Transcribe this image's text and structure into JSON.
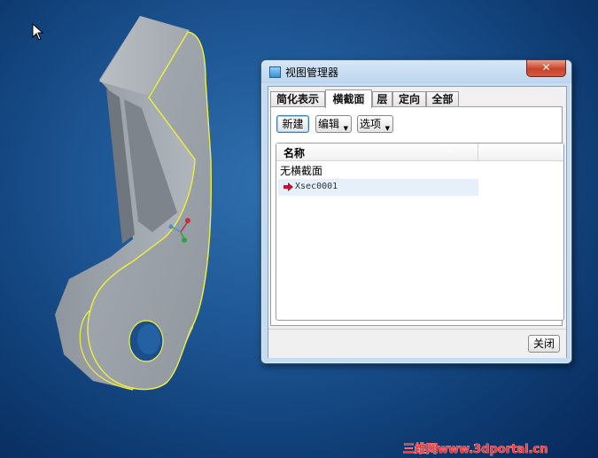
{
  "window": {
    "title": "视图管理器",
    "close_glyph": "✕"
  },
  "tabs": [
    {
      "label": "简化表示",
      "active": false
    },
    {
      "label": "横截面",
      "active": true
    },
    {
      "label": "层",
      "active": false
    },
    {
      "label": "定向",
      "active": false
    },
    {
      "label": "全部",
      "active": false
    }
  ],
  "toolbar": {
    "new_label": "新建",
    "edit_label": "编辑",
    "options_label": "选项"
  },
  "list": {
    "column_name": "名称",
    "rows": [
      {
        "label": "无横截面",
        "selected": false
      },
      {
        "label": "Xsec0001",
        "selected": true,
        "icon": "red-arrow-icon"
      }
    ]
  },
  "footer": {
    "close_label": "关闭"
  },
  "watermark": {
    "text": "三维网www.3dportal.cn"
  },
  "colors": {
    "background": "#1d5593",
    "part_edge": "#f0f03a",
    "close_button": "#c7432a",
    "selection": "#e6f0fa"
  }
}
